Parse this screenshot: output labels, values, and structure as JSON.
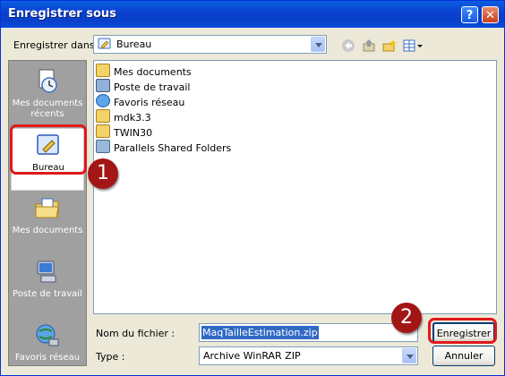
{
  "window": {
    "title": "Enregistrer sous",
    "help_label": "?",
    "close_label": "✕"
  },
  "save_in": {
    "label": "Enregistrer dans :",
    "value": "Bureau"
  },
  "toolbar": {
    "icons": [
      "back-icon",
      "up-folder-icon",
      "new-folder-icon",
      "view-menu-icon"
    ]
  },
  "places": [
    {
      "label": "Mes documents récents",
      "icon": "recent-documents-icon"
    },
    {
      "label": "Bureau",
      "icon": "desktop-icon",
      "selected": true
    },
    {
      "label": "Mes documents",
      "icon": "my-documents-icon"
    },
    {
      "label": "Poste de travail",
      "icon": "my-computer-icon"
    },
    {
      "label": "Favoris réseau",
      "icon": "network-places-icon"
    }
  ],
  "files": [
    {
      "name": "Mes documents",
      "icon": "my-documents-icon"
    },
    {
      "name": "Poste de travail",
      "icon": "my-computer-icon"
    },
    {
      "name": "Favoris réseau",
      "icon": "network-places-icon"
    },
    {
      "name": "mdk3.3",
      "icon": "folder-icon"
    },
    {
      "name": "TWIN30",
      "icon": "folder-icon"
    },
    {
      "name": "Parallels Shared Folders",
      "icon": "shared-folder-icon"
    }
  ],
  "filename": {
    "label": "Nom du fichier :",
    "value": "MaqTailleEstimation.zip"
  },
  "filetype": {
    "label": "Type :",
    "value": "Archive WinRAR ZIP"
  },
  "buttons": {
    "save": "Enregistrer",
    "cancel": "Annuler"
  },
  "annotations": {
    "step1": "1",
    "step2": "2"
  },
  "colors": {
    "titlebar": "#0a3fd0",
    "highlight": "#e0191b",
    "badge": "#a31616",
    "selection": "#316ac5"
  }
}
